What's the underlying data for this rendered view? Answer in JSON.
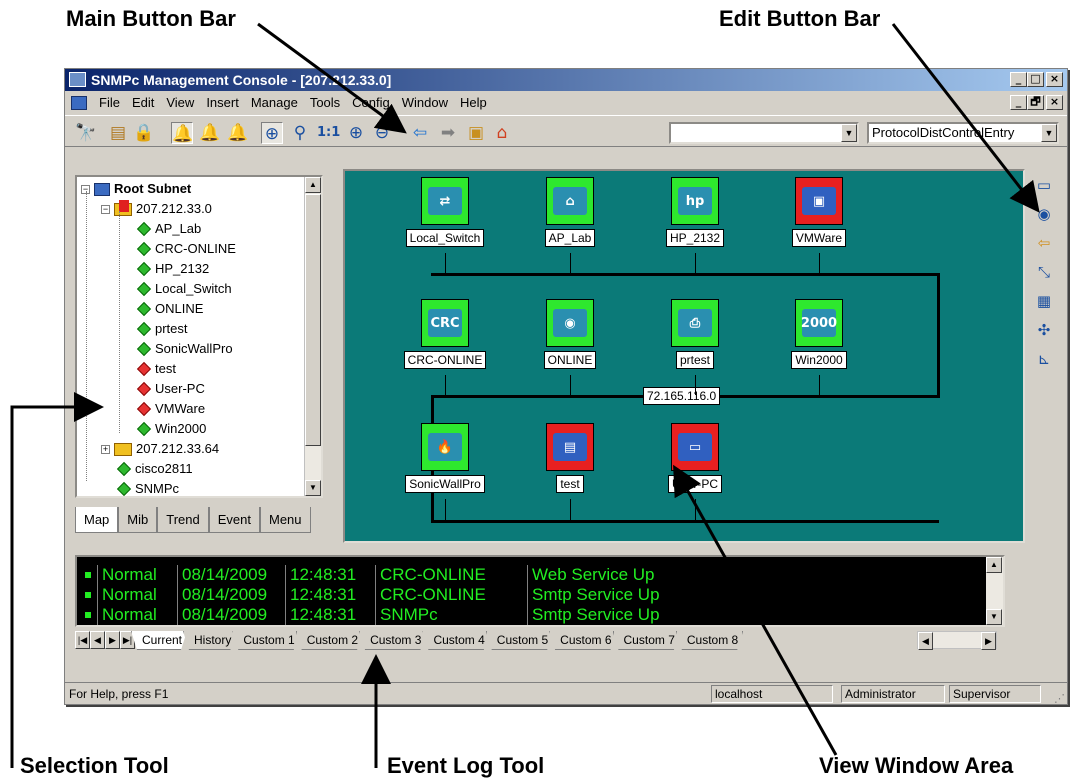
{
  "callouts": {
    "main_button_bar": "Main Button Bar",
    "edit_button_bar": "Edit Button Bar",
    "selection_tool": "Selection Tool",
    "event_log_tool": "Event Log Tool",
    "view_window_area": "View Window Area"
  },
  "window": {
    "title": "SNMPc Management Console - [207.212.33.0]",
    "caption_buttons": [
      "_",
      "□",
      "×"
    ],
    "mdi_buttons": [
      "_",
      "🗗",
      "×"
    ]
  },
  "menu": [
    "File",
    "Edit",
    "View",
    "Insert",
    "Manage",
    "Tools",
    "Config",
    "Window",
    "Help"
  ],
  "toolbar": {
    "icons": [
      "binoculars-icon",
      "properties-icon",
      "lock-icon",
      "alarm-bell-icon",
      "bell-icon",
      "bells-icon",
      "select-icon",
      "zoom-icon",
      "zoom-1to1-icon",
      "zoom-in-icon",
      "zoom-out-icon",
      "back-icon",
      "forward-icon",
      "up-folder-icon",
      "home-icon"
    ],
    "combo1_value": "",
    "combo2_value": "ProtocolDistControlEntry"
  },
  "tree": {
    "root": "Root Subnet",
    "subnet": "207.212.33.0",
    "children": [
      {
        "label": "AP_Lab",
        "status": "green"
      },
      {
        "label": "CRC-ONLINE",
        "status": "green"
      },
      {
        "label": "HP_2132",
        "status": "green"
      },
      {
        "label": "Local_Switch",
        "status": "green"
      },
      {
        "label": "ONLINE",
        "status": "green"
      },
      {
        "label": "prtest",
        "status": "green"
      },
      {
        "label": "SonicWallPro",
        "status": "green"
      },
      {
        "label": "test",
        "status": "red"
      },
      {
        "label": "User-PC",
        "status": "red"
      },
      {
        "label": "VMWare",
        "status": "red"
      },
      {
        "label": "Win2000",
        "status": "green"
      }
    ],
    "subnet2": "207.212.33.64",
    "extra": [
      {
        "label": "cisco2811",
        "status": "green"
      },
      {
        "label": "SNMPc",
        "status": "green"
      }
    ]
  },
  "selection_tabs": [
    "Map",
    "Mib",
    "Trend",
    "Event",
    "Menu"
  ],
  "map": {
    "network_label": "72.165.116.0",
    "nodes": [
      {
        "label": "Local_Switch",
        "status": "green",
        "glyph": "⇄"
      },
      {
        "label": "AP_Lab",
        "status": "green",
        "glyph": "⌂"
      },
      {
        "label": "HP_2132",
        "status": "green",
        "glyph": "hp"
      },
      {
        "label": "VMWare",
        "status": "red",
        "glyph": "▣"
      },
      {
        "label": "CRC-ONLINE",
        "status": "green",
        "glyph": "CRC"
      },
      {
        "label": "ONLINE",
        "status": "green",
        "glyph": "◉"
      },
      {
        "label": "prtest",
        "status": "green",
        "glyph": "⎙"
      },
      {
        "label": "Win2000",
        "status": "green",
        "glyph": "2000"
      },
      {
        "label": "SonicWallPro",
        "status": "green",
        "glyph": "🔥"
      },
      {
        "label": "test",
        "status": "red",
        "glyph": "▤"
      },
      {
        "label": "User-PC",
        "status": "red",
        "glyph": "▭"
      }
    ]
  },
  "edit_bar_icons": [
    "window-icon",
    "globe-icon",
    "arrow-icon",
    "link-icon",
    "group-icon",
    "network-icon",
    "tool-icon"
  ],
  "event_log": {
    "rows": [
      {
        "status": "Normal",
        "date": "08/14/2009",
        "time": "12:48:31",
        "source": "CRC-ONLINE",
        "message": "Web Service Up"
      },
      {
        "status": "Normal",
        "date": "08/14/2009",
        "time": "12:48:31",
        "source": "CRC-ONLINE",
        "message": "Smtp Service Up"
      },
      {
        "status": "Normal",
        "date": "08/14/2009",
        "time": "12:48:31",
        "source": "SNMPc",
        "message": "Smtp Service Up"
      }
    ],
    "tabs": [
      "Current",
      "History",
      "Custom 1",
      "Custom 2",
      "Custom 3",
      "Custom 4",
      "Custom 5",
      "Custom 6",
      "Custom 7",
      "Custom 8"
    ]
  },
  "status_bar": {
    "help": "For Help, press F1",
    "host": "localhost",
    "user": "Administrator",
    "role": "Supervisor"
  }
}
